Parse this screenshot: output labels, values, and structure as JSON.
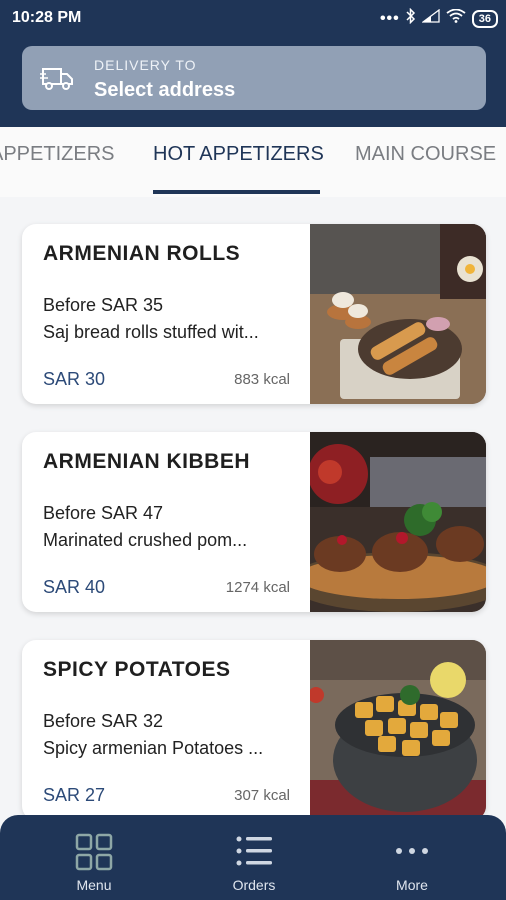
{
  "status_bar": {
    "time": "10:28 PM",
    "battery": "36"
  },
  "delivery": {
    "label": "DELIVERY TO",
    "value": "Select address"
  },
  "tabs": [
    {
      "label": "APPETIZERS"
    },
    {
      "label": "HOT APPETIZERS"
    },
    {
      "label": "MAIN COURSE"
    }
  ],
  "items": [
    {
      "title": "ARMENIAN ROLLS",
      "before": "Before SAR 35",
      "description": "Saj bread rolls stuffed wit...",
      "price": "SAR 30",
      "kcal": "883 kcal"
    },
    {
      "title": "ARMENIAN KIBBEH",
      "before": "Before SAR 47",
      "description": "Marinated crushed  pom...",
      "price": "SAR 40",
      "kcal": "1274 kcal"
    },
    {
      "title": "SPICY POTATOES",
      "before": "Before SAR 32",
      "description": "Spicy armenian Potatoes ...",
      "price": "SAR 27",
      "kcal": "307 kcal"
    }
  ],
  "bottom_nav": [
    {
      "label": "Menu",
      "icon": "grid-icon"
    },
    {
      "label": "Orders",
      "icon": "list-icon"
    },
    {
      "label": "More",
      "icon": "more-dots-icon"
    }
  ],
  "colors": {
    "primary": "#1f3557",
    "delivery_box": "#91a0b5",
    "price": "#2c4a78"
  }
}
